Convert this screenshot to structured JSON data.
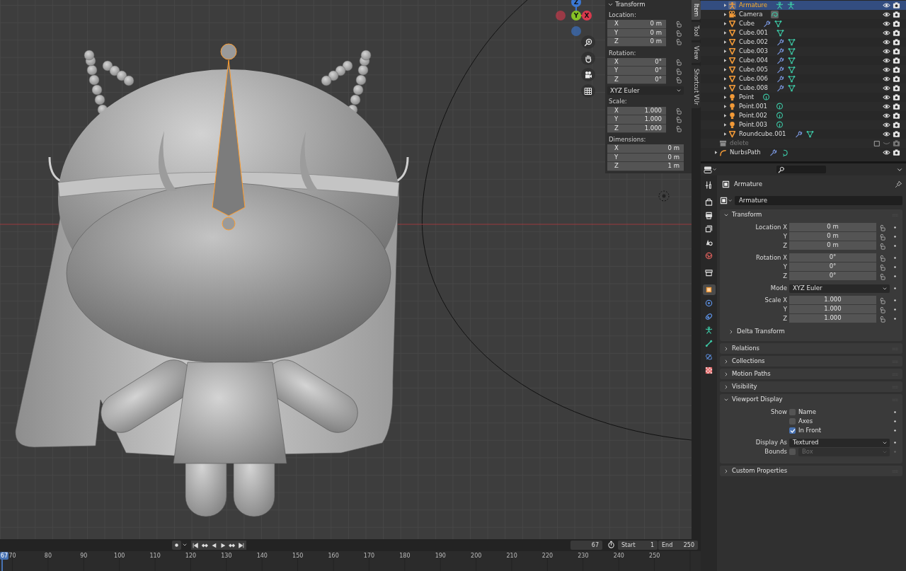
{
  "viewport": {
    "nav_gizmo": [
      {
        "label": "Z",
        "color": "#3b78d4"
      },
      {
        "label": "Y",
        "color": "#87c225"
      },
      {
        "label": "X",
        "color": "#d9394d"
      }
    ],
    "tools": [
      {
        "kind": "zoom"
      },
      {
        "kind": "pan"
      },
      {
        "kind": "camera"
      },
      {
        "kind": "grid"
      }
    ]
  },
  "sidebar": {
    "tabs": [
      {
        "label": "Item",
        "selected": true
      },
      {
        "label": "Tool",
        "selected": false
      },
      {
        "label": "View",
        "selected": false
      },
      {
        "label": "Shortcut VUr",
        "selected": false
      }
    ],
    "panel_title": "Transform",
    "groups": [
      {
        "label": "Location:",
        "lockable": true,
        "fields": [
          {
            "axis": "X",
            "value": "0 m"
          },
          {
            "axis": "Y",
            "value": "0 m"
          },
          {
            "axis": "Z",
            "value": "0 m"
          }
        ]
      },
      {
        "label": "Rotation:",
        "lockable": true,
        "fields": [
          {
            "axis": "X",
            "value": "0°"
          },
          {
            "axis": "Y",
            "value": "0°"
          },
          {
            "axis": "Z",
            "value": "0°"
          }
        ],
        "mode": "XYZ Euler"
      },
      {
        "label": "Scale:",
        "lockable": true,
        "fields": [
          {
            "axis": "X",
            "value": "1.000"
          },
          {
            "axis": "Y",
            "value": "1.000"
          },
          {
            "axis": "Z",
            "value": "1.000"
          }
        ]
      },
      {
        "label": "Dimensions:",
        "lockable": false,
        "fields": [
          {
            "axis": "X",
            "value": "0 m"
          },
          {
            "axis": "Y",
            "value": "0 m"
          },
          {
            "axis": "Z",
            "value": "1 m"
          }
        ]
      }
    ]
  },
  "outliner": {
    "nested_items": [
      {
        "name": "Armature",
        "kind": "armature",
        "selected": true,
        "data_icons": [
          {
            "kind": "armature"
          },
          {
            "kind": "armature"
          }
        ]
      },
      {
        "name": "Camera",
        "kind": "camera",
        "selected": false,
        "data_icons": [
          {
            "kind": "camera"
          }
        ]
      },
      {
        "name": "Cube",
        "kind": "mesh",
        "selected": false,
        "data_icons": [
          {
            "kind": "modifier"
          },
          {
            "kind": "mesh"
          }
        ]
      },
      {
        "name": "Cube.001",
        "kind": "mesh",
        "selected": false,
        "data_icons": [
          {
            "kind": "mesh"
          }
        ]
      },
      {
        "name": "Cube.002",
        "kind": "mesh",
        "selected": false,
        "data_icons": [
          {
            "kind": "modifier"
          },
          {
            "kind": "mesh"
          }
        ]
      },
      {
        "name": "Cube.003",
        "kind": "mesh",
        "selected": false,
        "data_icons": [
          {
            "kind": "modifier"
          },
          {
            "kind": "mesh"
          }
        ]
      },
      {
        "name": "Cube.004",
        "kind": "mesh",
        "selected": false,
        "data_icons": [
          {
            "kind": "modifier"
          },
          {
            "kind": "mesh"
          }
        ]
      },
      {
        "name": "Cube.005",
        "kind": "mesh",
        "selected": false,
        "data_icons": [
          {
            "kind": "modifier"
          },
          {
            "kind": "mesh"
          }
        ]
      },
      {
        "name": "Cube.006",
        "kind": "mesh",
        "selected": false,
        "data_icons": [
          {
            "kind": "modifier"
          },
          {
            "kind": "mesh"
          }
        ]
      },
      {
        "name": "Cube.008",
        "kind": "mesh",
        "selected": false,
        "data_icons": [
          {
            "kind": "modifier"
          },
          {
            "kind": "mesh"
          }
        ]
      },
      {
        "name": "Point",
        "kind": "light",
        "selected": false,
        "data_icons": [
          {
            "kind": "light"
          }
        ]
      },
      {
        "name": "Point.001",
        "kind": "light",
        "selected": false,
        "data_icons": [
          {
            "kind": "light"
          }
        ]
      },
      {
        "name": "Point.002",
        "kind": "light",
        "selected": false,
        "data_icons": [
          {
            "kind": "light"
          }
        ]
      },
      {
        "name": "Point.003",
        "kind": "light",
        "selected": false,
        "data_icons": [
          {
            "kind": "light"
          }
        ]
      },
      {
        "name": "Roundcube.001",
        "kind": "mesh",
        "selected": false,
        "data_icons": [
          {
            "kind": "modifier"
          },
          {
            "kind": "mesh"
          }
        ]
      }
    ],
    "items": [
      {
        "name": "delete",
        "kind": "collection",
        "excluded": true
      },
      {
        "name": "NurbsPath",
        "kind": "curve",
        "excluded": false,
        "data_icons": [
          {
            "kind": "modifier"
          },
          {
            "kind": "curve"
          }
        ]
      }
    ]
  },
  "properties": {
    "tabs": [
      {
        "kind": "tool",
        "selected": false
      },
      {
        "kind": "render",
        "selected": false
      },
      {
        "kind": "output",
        "selected": false
      },
      {
        "kind": "view-layer",
        "selected": false
      },
      {
        "kind": "scene",
        "selected": false
      },
      {
        "kind": "world",
        "selected": false
      },
      {
        "kind": "collection",
        "selected": false
      },
      {
        "kind": "object",
        "selected": true
      },
      {
        "kind": "physics",
        "selected": false
      },
      {
        "kind": "constraints",
        "selected": false
      },
      {
        "kind": "armature",
        "selected": false
      },
      {
        "kind": "bone",
        "selected": false
      },
      {
        "kind": "bone-constraints",
        "selected": false
      },
      {
        "kind": "texture",
        "selected": false
      }
    ],
    "context": "Armature",
    "datablock": "Armature",
    "panels": [
      {
        "title": "Transform",
        "expanded": true,
        "row_groups": [
          [
            {
              "kind": "number",
              "label": "Location X",
              "value": "0 m"
            },
            {
              "kind": "number",
              "label": "Y",
              "value": "0 m"
            },
            {
              "kind": "number",
              "label": "Z",
              "value": "0 m"
            }
          ],
          [
            {
              "kind": "number",
              "label": "Rotation X",
              "value": "0°"
            },
            {
              "kind": "number",
              "label": "Y",
              "value": "0°"
            },
            {
              "kind": "number",
              "label": "Z",
              "value": "0°"
            }
          ],
          [
            {
              "kind": "dropdown",
              "label": "Mode",
              "value": "XYZ Euler"
            }
          ],
          [
            {
              "kind": "number",
              "label": "Scale X",
              "value": "1.000"
            },
            {
              "kind": "number",
              "label": "Y",
              "value": "1.000"
            },
            {
              "kind": "number",
              "label": "Z",
              "value": "1.000"
            }
          ]
        ],
        "subpanels": [
          {
            "title": "Delta Transform",
            "expanded": false
          }
        ]
      },
      {
        "title": "Relations",
        "expanded": false
      },
      {
        "title": "Collections",
        "expanded": false
      },
      {
        "title": "Motion Paths",
        "expanded": false
      },
      {
        "title": "Visibility",
        "expanded": false
      },
      {
        "title": "Viewport Display",
        "expanded": true,
        "row_groups": [
          [
            {
              "kind": "checkbox",
              "label": "Show",
              "text": "Name",
              "checked": false
            },
            {
              "kind": "checkbox",
              "text": "Axes",
              "checked": false
            },
            {
              "kind": "checkbox",
              "text": "In Front",
              "checked": true
            }
          ],
          [
            {
              "kind": "dropdown",
              "label": "Display As",
              "value": "Textured"
            },
            {
              "kind": "checkbox-dropdown",
              "label": "Bounds",
              "checked": false,
              "value": "Box",
              "disabled": true
            }
          ]
        ]
      },
      {
        "title": "Custom Properties",
        "expanded": false
      }
    ]
  },
  "timeline": {
    "controls": [
      {
        "kind": "jump-start"
      },
      {
        "kind": "prev-key"
      },
      {
        "kind": "play-reverse"
      },
      {
        "kind": "play"
      },
      {
        "kind": "next-key"
      },
      {
        "kind": "jump-end"
      }
    ],
    "current_frame": "67",
    "start": {
      "label": "Start",
      "value": "1"
    },
    "end": {
      "label": "End",
      "value": "250"
    },
    "ruler": {
      "current": "67",
      "ticks": [
        "70",
        "80",
        "90",
        "100",
        "110",
        "120",
        "130",
        "140",
        "150",
        "160",
        "170",
        "180",
        "190",
        "200",
        "210",
        "220",
        "230",
        "240",
        "250"
      ]
    }
  }
}
